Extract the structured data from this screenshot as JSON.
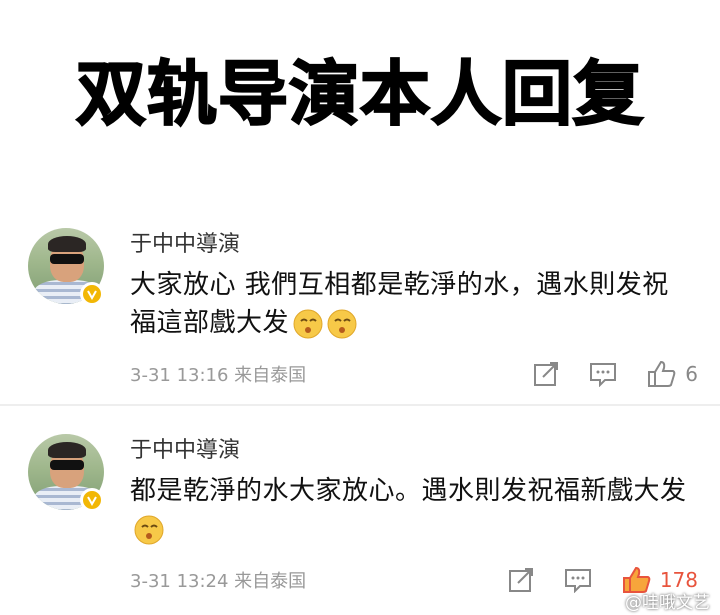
{
  "headline": "双轨导演本人回复",
  "comments": [
    {
      "author": "于中中導演",
      "text": "大家放心 我們互相都是乾淨的水，遇水則发祝福這部戲大发",
      "meta": "3-31 13:16  来自泰国",
      "likes": "6",
      "like_color": "#888888"
    },
    {
      "author": "于中中導演",
      "text": "都是乾淨的水大家放心。遇水則发祝福新戲大发",
      "meta": "3-31 13:24  来自泰国",
      "likes": "178",
      "like_color": "#e8543d"
    }
  ],
  "icons": [
    "share-icon",
    "comment-icon",
    "like-icon",
    "verified-badge-icon",
    "emoji-icon"
  ],
  "watermark": "@哇哦文艺"
}
